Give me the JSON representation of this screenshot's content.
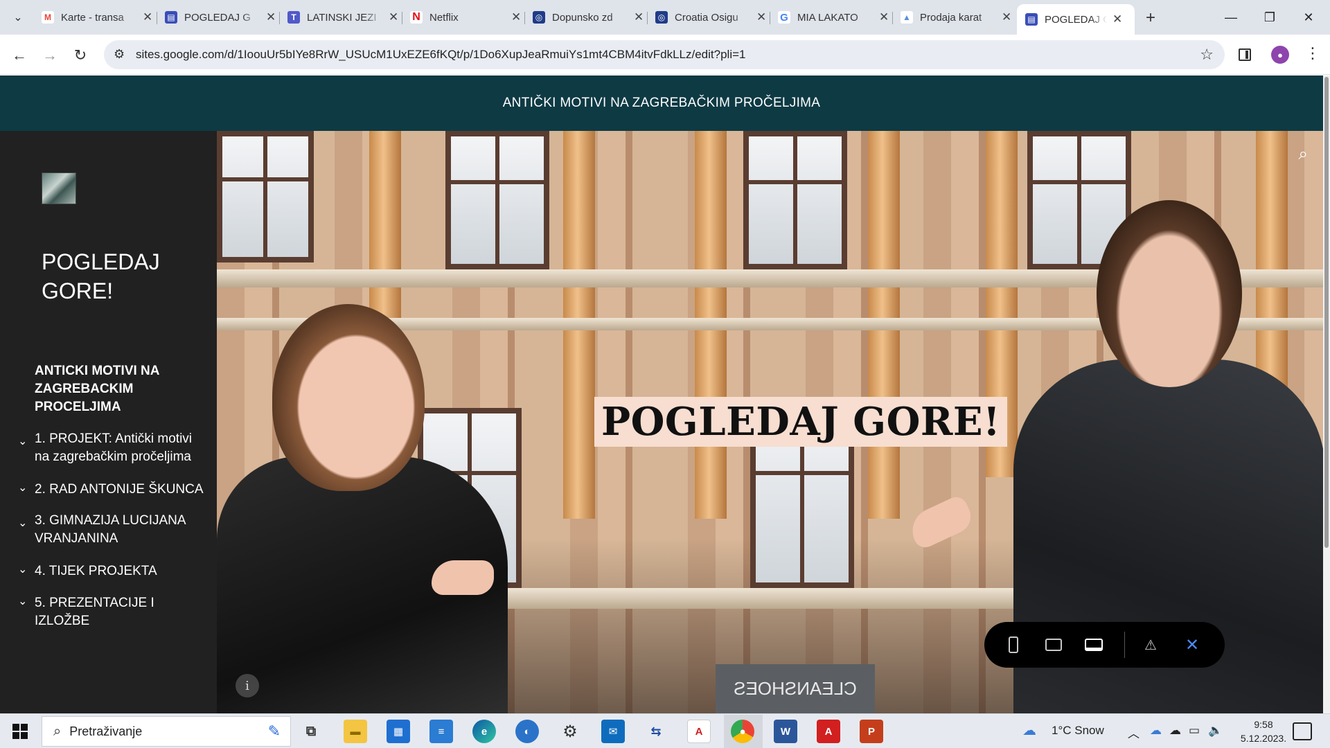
{
  "browser": {
    "tabs": [
      {
        "title": "Karte - transa",
        "favicon": "gmail-icon",
        "color": "#ea4335",
        "glyph": "M"
      },
      {
        "title": "POGLEDAJ G",
        "favicon": "google-sites-icon",
        "color": "#3a4eb8",
        "glyph": "▤"
      },
      {
        "title": "LATINSKI JEZI",
        "favicon": "teams-icon",
        "color": "#5059c9",
        "glyph": "T"
      },
      {
        "title": "Netflix",
        "favicon": "netflix-icon",
        "color": "#e50914",
        "glyph": "N"
      },
      {
        "title": "Dopunsko zd",
        "favicon": "croatia-osig-icon",
        "color": "#1f3c88",
        "glyph": "◎"
      },
      {
        "title": "Croatia Osigu",
        "favicon": "croatia-osig-icon",
        "color": "#1f3c88",
        "glyph": "◎"
      },
      {
        "title": "MIA LAKATO",
        "favicon": "google-icon",
        "color": "#4285f4",
        "glyph": "G"
      },
      {
        "title": "Prodaja karat",
        "favicon": "mountain-icon",
        "color": "#5b8fd9",
        "glyph": "▲"
      },
      {
        "title": "POGLEDAJ G",
        "favicon": "google-sites-icon",
        "color": "#3a4eb8",
        "glyph": "▤"
      }
    ],
    "url": "sites.google.com/d/1IoouUr5bIYe8RrW_USUcM1UxEZE6fKQt/p/1Do6XupJeaRmuiYs1mt4CBM4itvFdkLLz/edit?pli=1"
  },
  "site": {
    "header_title": "ANTIČKI MOTIVI NA ZAGREBAČKIM PROČELJIMA",
    "site_title": "POGLEDAJ GORE!",
    "nav_top": "ANTICKI MOTIVI NA ZAGREBACKIM PROCELJIMA",
    "nav_items": [
      "1. PROJEKT: Antički motivi na zagrebačkim pročeljima",
      "2. RAD ANTONIJE ŠKUNCA",
      "3. GIMNAZIJA LUCIJANA VRANJANINA",
      "4. TIJEK PROJEKTA",
      "5. PREZENTACIJE I IZLOŽBE"
    ],
    "hero_title": "POGLEDAJ GORE!",
    "shop_sign": "CLEANSHOES"
  },
  "taskbar": {
    "search_placeholder": "Pretraživanje",
    "weather": "1°C  Snow",
    "time": "9:58",
    "date": "5.12.2023."
  },
  "colors": {
    "header_bg": "#0e3a44",
    "sidebar_bg": "#212121",
    "hero_title_bg": "#f7ded0"
  }
}
